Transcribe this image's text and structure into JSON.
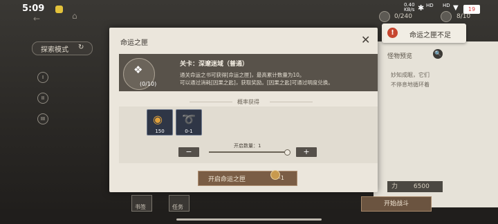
{
  "status_bar": {
    "time": "5:09",
    "net_speed": "0.40",
    "net_unit": "KB/s",
    "signal1": "HD",
    "signal2": "HD",
    "battery": "19"
  },
  "resources": {
    "res1": "0/240",
    "res2": "8/10"
  },
  "explore": {
    "label": "探索模式",
    "levels": [
      "I",
      "II",
      "III"
    ]
  },
  "toast": {
    "message": "命运之匣不足"
  },
  "modal": {
    "title": "命运之匣",
    "stage": "关卡：深邃迷域（普通）",
    "emblem_count": "(0/10)",
    "desc_line1": "通关命运之书可获得[命运之匣]，最高累计数量为10。",
    "desc_line2": "可以通过消耗[因果之匙]，获取奖励。[因果之匙]可通过明度兑换。",
    "prob_label": "概率获得",
    "rewards": [
      {
        "qty": "150",
        "icon": "gold-orb-icon"
      },
      {
        "qty": "0-1",
        "icon": "silver-serpent-icon"
      }
    ],
    "open_count_label": "开启数量：1",
    "minus": "−",
    "plus": "+",
    "open_button": "开启命运之匣",
    "open_cost": "-1"
  },
  "background": {
    "preview_label": "怪物预览",
    "desc_fragments": [
      "妙知成眠，它们",
      "不停息地循环着"
    ],
    "power_label": "力",
    "power_value": "6500",
    "start_button": "开始战斗",
    "tabs": [
      "书签",
      "任务"
    ]
  }
}
